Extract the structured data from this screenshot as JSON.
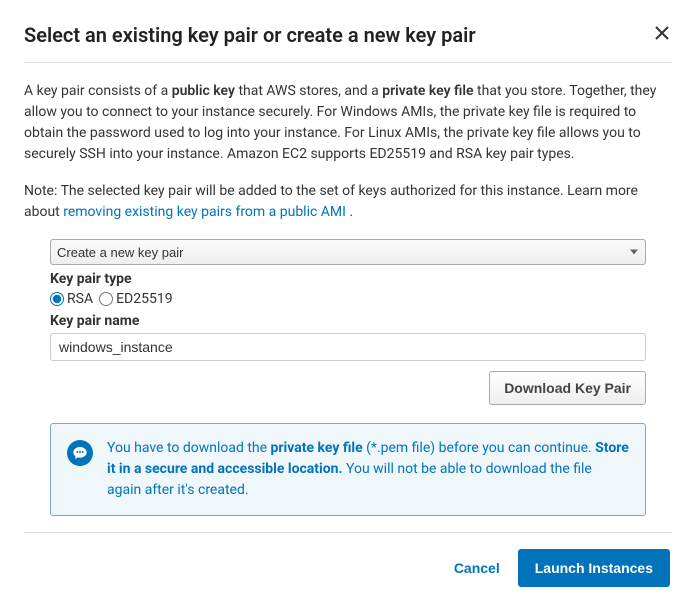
{
  "dialog": {
    "title": "Select an existing key pair or create a new key pair",
    "intro_parts": {
      "p1": "A key pair consists of a ",
      "b1": "public key",
      "p2": " that AWS stores, and a ",
      "b2": "private key file",
      "p3": " that you store. Together, they allow you to connect to your instance securely. For Windows AMIs, the private key file is required to obtain the password used to log into your instance. For Linux AMIs, the private key file allows you to securely SSH into your instance. Amazon EC2 supports ED25519 and RSA key pair types."
    },
    "note_parts": {
      "prefix": "Note: The selected key pair will be added to the set of keys authorized for this instance. Learn more about ",
      "link": "removing existing key pairs from a public AMI",
      "suffix": " ."
    },
    "form": {
      "select_value": "Create a new key pair",
      "type_label": "Key pair type",
      "type_options": {
        "rsa": "RSA",
        "ed25519": "ED25519"
      },
      "type_selected": "rsa",
      "name_label": "Key pair name",
      "name_value": "windows_instance",
      "download_label": "Download Key Pair"
    },
    "info": {
      "p1": "You have to download the ",
      "b1": "private key file",
      "p2": " (*.pem file) before you can continue. ",
      "b2": "Store it in a secure and accessible location.",
      "p3": " You will not be able to download the file again after it's created."
    },
    "footer": {
      "cancel": "Cancel",
      "launch": "Launch Instances"
    }
  }
}
